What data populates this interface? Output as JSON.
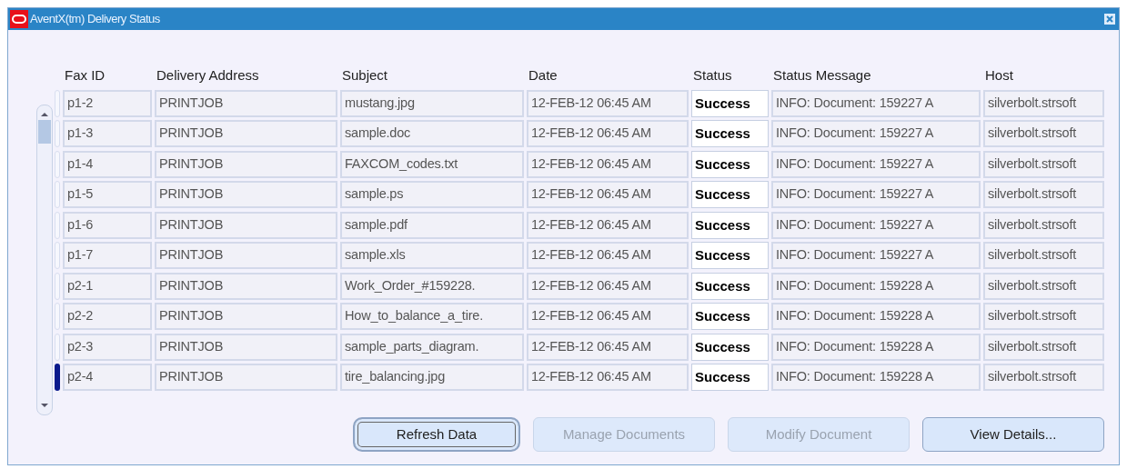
{
  "window": {
    "title": "AventX(tm) Delivery Status"
  },
  "table": {
    "columns": [
      "Fax ID",
      "Delivery Address",
      "Subject",
      "Date",
      "Status",
      "Status Message",
      "Host"
    ],
    "rows": [
      {
        "selected": false,
        "cells": [
          "p1-2",
          "PRINTJOB",
          "mustang.jpg",
          "12-FEB-12 06:45 AM",
          "Success",
          "INFO: Document: 159227 A",
          "silverbolt.strsoft"
        ]
      },
      {
        "selected": false,
        "cells": [
          "p1-3",
          "PRINTJOB",
          "sample.doc",
          "12-FEB-12 06:45 AM",
          "Success",
          "INFO: Document: 159227 A",
          "silverbolt.strsoft"
        ]
      },
      {
        "selected": false,
        "cells": [
          "p1-4",
          "PRINTJOB",
          "FAXCOM_codes.txt",
          "12-FEB-12 06:45 AM",
          "Success",
          "INFO: Document: 159227 A",
          "silverbolt.strsoft"
        ]
      },
      {
        "selected": false,
        "cells": [
          "p1-5",
          "PRINTJOB",
          "sample.ps",
          "12-FEB-12 06:45 AM",
          "Success",
          "INFO: Document: 159227 A",
          "silverbolt.strsoft"
        ]
      },
      {
        "selected": false,
        "cells": [
          "p1-6",
          "PRINTJOB",
          "sample.pdf",
          "12-FEB-12 06:45 AM",
          "Success",
          "INFO: Document: 159227 A",
          "silverbolt.strsoft"
        ]
      },
      {
        "selected": false,
        "cells": [
          "p1-7",
          "PRINTJOB",
          "sample.xls",
          "12-FEB-12 06:45 AM",
          "Success",
          "INFO: Document: 159227 A",
          "silverbolt.strsoft"
        ]
      },
      {
        "selected": false,
        "cells": [
          "p2-1",
          "PRINTJOB",
          "Work_Order_#159228.",
          "12-FEB-12 06:45 AM",
          "Success",
          "INFO: Document: 159228 A",
          "silverbolt.strsoft"
        ]
      },
      {
        "selected": false,
        "cells": [
          "p2-2",
          "PRINTJOB",
          "How_to_balance_a_tire.",
          "12-FEB-12 06:45 AM",
          "Success",
          "INFO: Document: 159228 A",
          "silverbolt.strsoft"
        ]
      },
      {
        "selected": false,
        "cells": [
          "p2-3",
          "PRINTJOB",
          "sample_parts_diagram.",
          "12-FEB-12 06:45 AM",
          "Success",
          "INFO: Document: 159228 A",
          "silverbolt.strsoft"
        ]
      },
      {
        "selected": true,
        "cells": [
          "p2-4",
          "PRINTJOB",
          "tire_balancing.jpg",
          "12-FEB-12 06:45 AM",
          "Success",
          "INFO: Document: 159228 A",
          "silverbolt.strsoft"
        ]
      }
    ]
  },
  "buttons": [
    {
      "label": "Refresh Data",
      "disabled": false,
      "focused": true
    },
    {
      "label": "Manage Documents",
      "disabled": true,
      "focused": false
    },
    {
      "label": "Modify Document",
      "disabled": true,
      "focused": false
    },
    {
      "label": "View Details...",
      "disabled": false,
      "focused": false
    }
  ]
}
